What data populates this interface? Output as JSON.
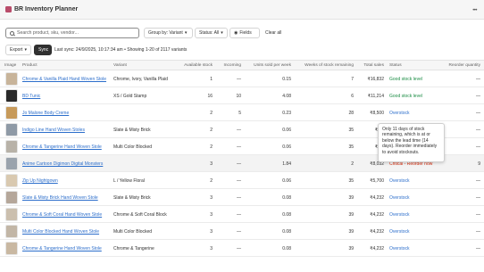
{
  "app": {
    "title": "BR Inventory Planner"
  },
  "colors": {
    "link": "#2c6ecb",
    "good": "#1a8c43",
    "critical": "#d82c0d",
    "sync_bg": "#303030"
  },
  "filters": {
    "search_placeholder": "Search product, sku, vendor...",
    "group_by": "Group by: Variant",
    "status": "Status: All",
    "fields": "Fields",
    "clear_all": "Clear all"
  },
  "toolbar": {
    "export": "Export",
    "sync": "Sync",
    "sync_info": "Last sync: 24/9/2025, 10:17:34 am • Showing 1-20 of 2117 variants"
  },
  "table": {
    "headers": {
      "image": "Image",
      "product": "Product",
      "variant": "Variant",
      "available": "Available stock",
      "incoming": "Incoming",
      "units_sold": "Units sold per week",
      "weeks": "Weeks of stock remaining",
      "total_sales": "Total sales",
      "status": "Status",
      "reorder": "Reorder quantity"
    },
    "rows": [
      {
        "product": "Chrome & Vanilla Plaid Hand Woven Stole",
        "variant": "Chrome, Ivory, Vanilla Plaid",
        "available": "1",
        "incoming": "—",
        "units": "0.15",
        "weeks": "7",
        "sales": "₹16,832",
        "status": "Good stock level",
        "status_type": "good",
        "reorder": "—",
        "thumb": "#c8b49a"
      },
      {
        "product": "BD Tunic",
        "variant": "XS / Gold Stamp",
        "available": "16",
        "incoming": "10",
        "units": "4.08",
        "weeks": "6",
        "sales": "₹11,214",
        "status": "Good stock level",
        "status_type": "good",
        "reorder": "—",
        "thumb": "#2a2a2a"
      },
      {
        "product": "Jo Malone Body Creme",
        "variant": "",
        "available": "2",
        "incoming": "5",
        "units": "0.23",
        "weeks": "28",
        "sales": "₹8,500",
        "status": "Overstock",
        "status_type": "over",
        "reorder": "—",
        "thumb": "#c79a5a"
      },
      {
        "product": "Indigo Line Hand Woven Stoles",
        "variant": "Slate & Misty Brick",
        "available": "2",
        "incoming": "—",
        "units": "0.06",
        "weeks": "35",
        "sales": "₹6,3",
        "status": "",
        "status_type": "over",
        "reorder": "—",
        "thumb": "#8f9aa6"
      },
      {
        "product": "Chrome & Tangerine Hand Woven Stole",
        "variant": "Multi Color Blocked",
        "available": "2",
        "incoming": "—",
        "units": "0.06",
        "weeks": "35",
        "sales": "₹6,3",
        "status": "",
        "status_type": "over",
        "reorder": "—",
        "thumb": "#b8b2a8"
      },
      {
        "product": "Anime Cartoon Digimon Digital Monsters",
        "variant": "",
        "available": "3",
        "incoming": "—",
        "units": "1.84",
        "weeks": "2",
        "sales": "₹8,032",
        "status": "Critical - Reorder now",
        "status_type": "crit",
        "reorder": "9",
        "thumb": "#9aa3ad"
      },
      {
        "product": "Zip Up Nightgown",
        "variant": "L / Yellow Floral",
        "available": "2",
        "incoming": "—",
        "units": "0.06",
        "weeks": "35",
        "sales": "₹5,700",
        "status": "Overstock",
        "status_type": "over",
        "reorder": "—",
        "thumb": "#d9c9b0"
      },
      {
        "product": "Slate & Misty Brick Hand Woven Stole",
        "variant": "Slate & Misty Brick",
        "available": "3",
        "incoming": "—",
        "units": "0.08",
        "weeks": "39",
        "sales": "₹4,232",
        "status": "Overstock",
        "status_type": "over",
        "reorder": "—",
        "thumb": "#b5a79a"
      },
      {
        "product": "Chrome & Soft Coral Hand Woven Stole",
        "variant": "Chrome & Soft Coral Block",
        "available": "3",
        "incoming": "—",
        "units": "0.08",
        "weeks": "39",
        "sales": "₹4,232",
        "status": "Overstock",
        "status_type": "over",
        "reorder": "—",
        "thumb": "#cbbfae"
      },
      {
        "product": "Multi Color Blocked Hand Woven Stole",
        "variant": "Multi Color Blocked",
        "available": "3",
        "incoming": "—",
        "units": "0.08",
        "weeks": "39",
        "sales": "₹4,232",
        "status": "Overstock",
        "status_type": "over",
        "reorder": "—",
        "thumb": "#c2b6a6"
      },
      {
        "product": "Chrome & Tangerine Hand Woven Stole",
        "variant": "Chrome & Tangerine",
        "available": "3",
        "incoming": "—",
        "units": "0.08",
        "weeks": "39",
        "sales": "₹4,232",
        "status": "Overstock",
        "status_type": "over",
        "reorder": "—",
        "thumb": "#c9b8a2"
      }
    ]
  },
  "tooltip": {
    "line1": "Only 11 days of stock",
    "line2": "remaining, which is at or",
    "line3": "below the lead time (14",
    "line4": "days). Reorder immediately",
    "line5": "to avoid stockouts."
  }
}
